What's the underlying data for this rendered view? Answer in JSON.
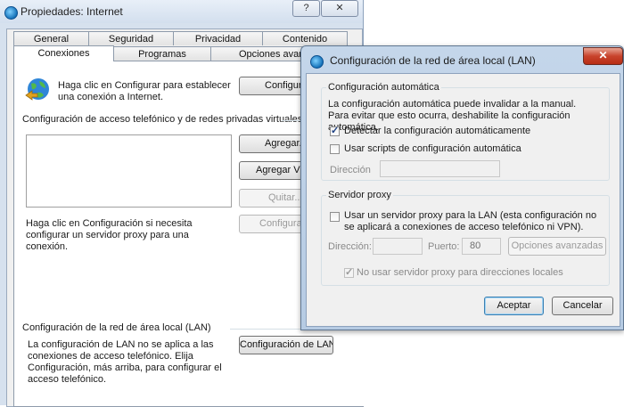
{
  "back_window": {
    "title": "Propiedades: Internet",
    "help_btn": "?",
    "close_btn": "✕",
    "tabs_row1": [
      "General",
      "Seguridad",
      "Privacidad",
      "Contenido"
    ],
    "tabs_row2": [
      "Conexiones",
      "Programas",
      "Opciones avanzadas"
    ],
    "active_tab": "Conexiones",
    "setup_text": "Haga clic en Configurar para establecer una conexión a Internet.",
    "setup_button": "Configurar",
    "dialup_heading": "Configuración de acceso telefónico y de redes privadas virtuales",
    "add_button": "Agregar...",
    "add_vpn_button": "Agregar VPN...",
    "remove_button": "Quitar...",
    "settings_text": "Haga clic en Configuración si necesita configurar un servidor proxy para una conexión.",
    "settings_button": "Configuración",
    "lan_heading": "Configuración de la red de área local (LAN)",
    "lan_text": "La configuración de LAN no se aplica a las conexiones de acceso telefónico. Elija Configuración, más arriba, para configurar el acceso telefónico.",
    "lan_button": "Configuración de LAN"
  },
  "lan_dialog": {
    "title": "Configuración de la red de área local (LAN)",
    "close_btn": "✕",
    "auto_group": "Configuración automática",
    "auto_desc": "La configuración automática puede invalidar a la manual. Para evitar que esto ocurra, deshabilite la configuración automática.",
    "detect_label": "Detectar la configuración automáticamente",
    "detect_checked": true,
    "script_label": "Usar scripts de configuración automática",
    "script_checked": false,
    "address_label": "Dirección",
    "address_value": "",
    "proxy_group": "Servidor proxy",
    "proxy_label": "Usar un servidor proxy para la LAN (esta configuración no se aplicará a conexiones de acceso telefónico ni VPN).",
    "proxy_checked": false,
    "proxy_address_label": "Dirección:",
    "proxy_address_value": "",
    "port_label": "Puerto:",
    "port_value": "80",
    "advanced_button": "Opciones avanzadas",
    "bypass_label": "No usar servidor proxy para direcciones locales",
    "bypass_checked": true,
    "ok_button": "Aceptar",
    "cancel_button": "Cancelar"
  }
}
